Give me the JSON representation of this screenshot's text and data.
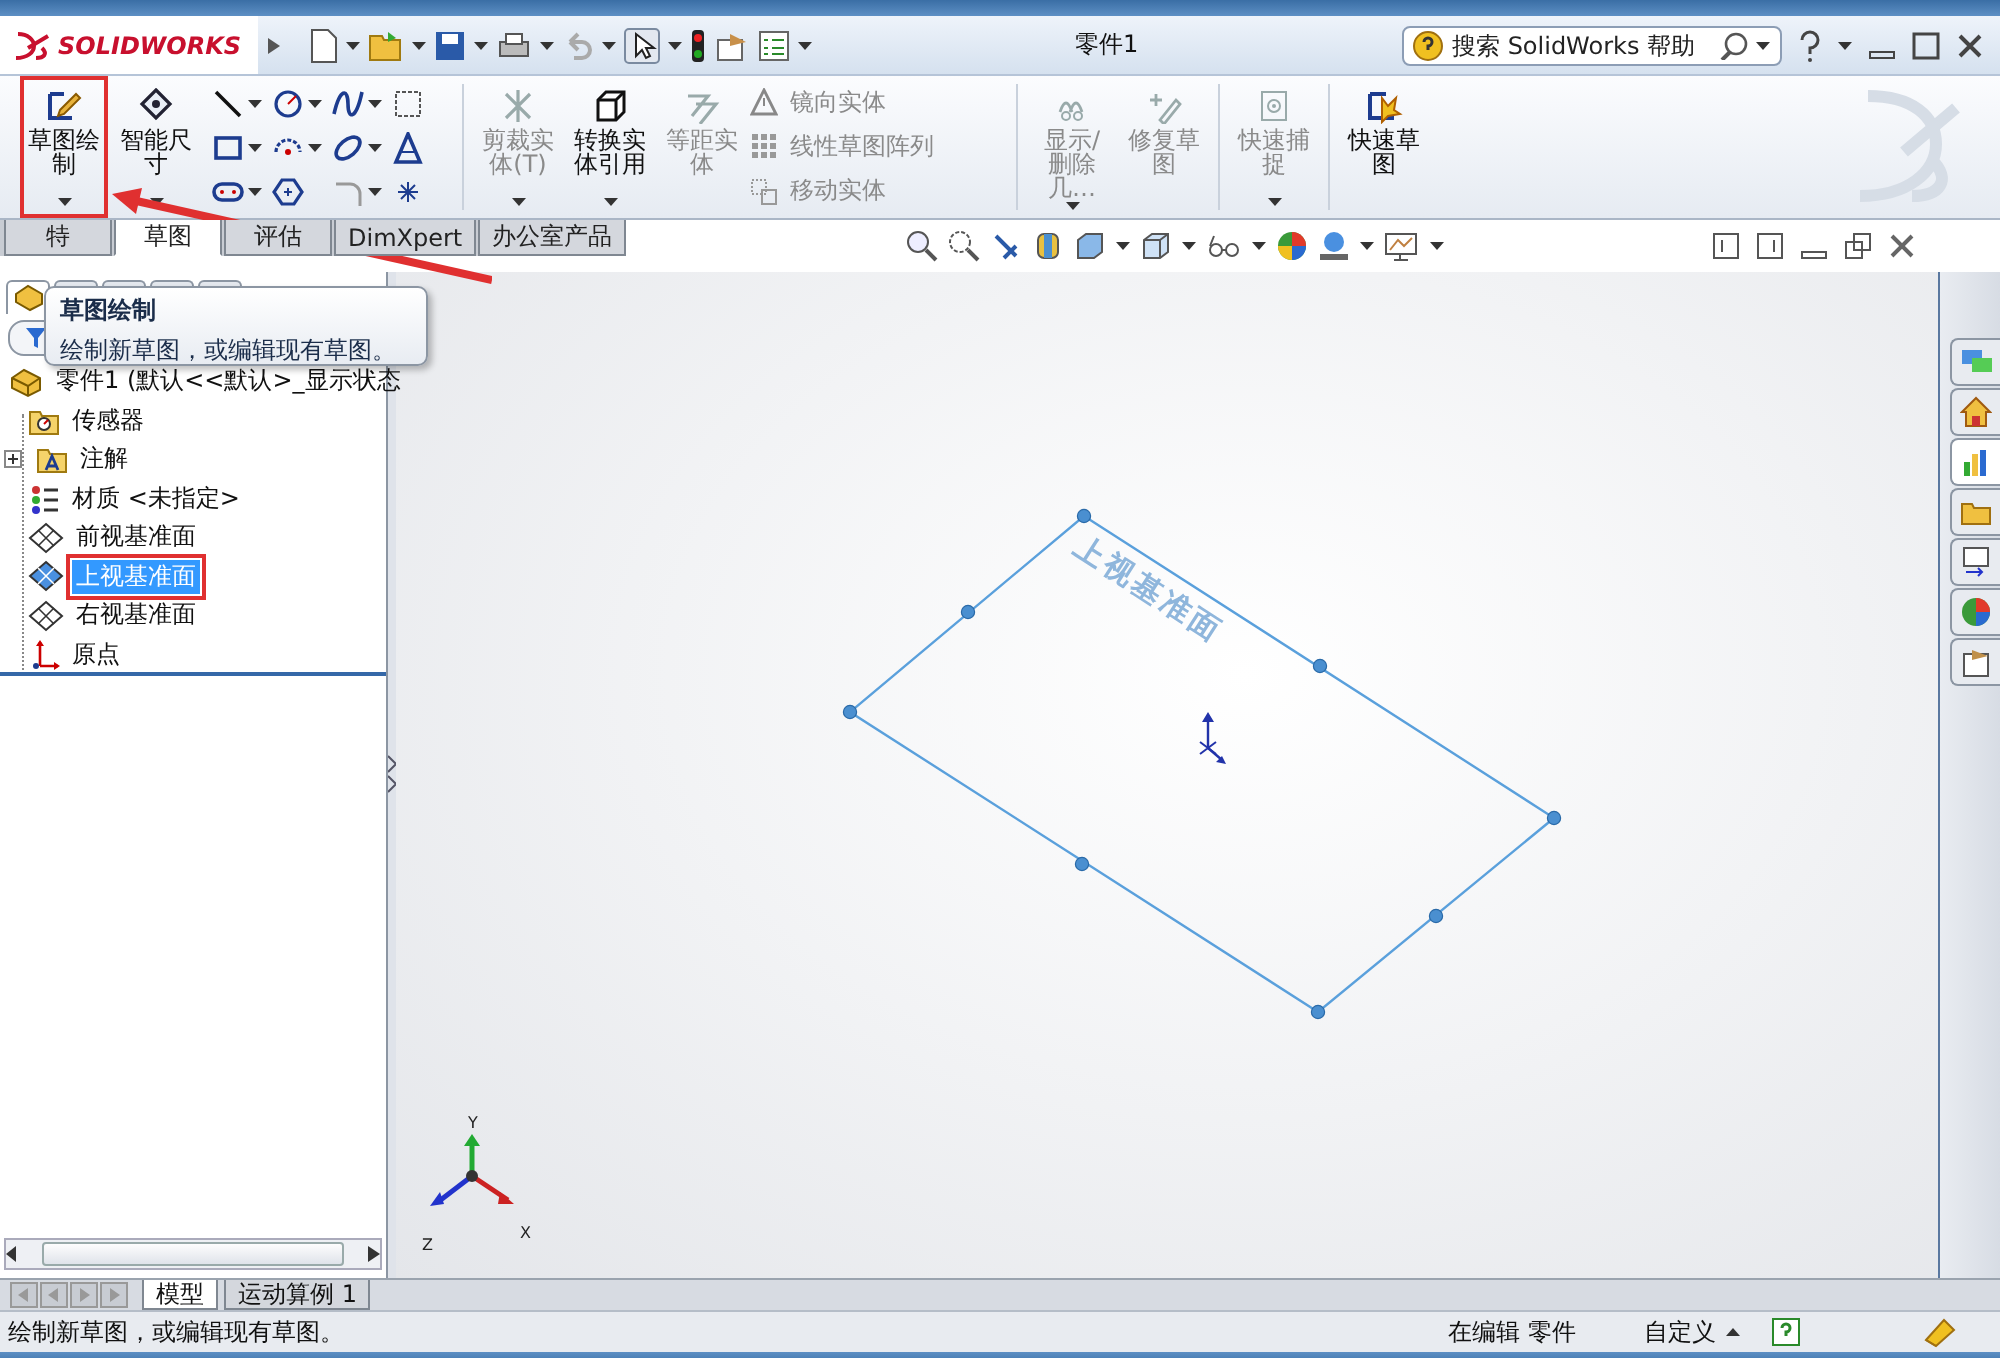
{
  "window": {
    "title": "零件1"
  },
  "logo": {
    "text": "SOLIDWORKS"
  },
  "search": {
    "placeholder": "搜索 SolidWorks 帮助"
  },
  "ribbon": {
    "items": [
      {
        "kind": "large",
        "label": "草图绘制",
        "disabled": false,
        "highlighted": true,
        "dropdown": true
      },
      {
        "kind": "large",
        "label": "智能尺寸",
        "disabled": false,
        "highlighted": false,
        "dropdown": true
      },
      {
        "kind": "tools"
      },
      {
        "kind": "large",
        "label": "剪裁实体(T)",
        "disabled": true,
        "highlighted": false,
        "dropdown": true
      },
      {
        "kind": "large",
        "label": "转换实体引用",
        "disabled": false,
        "highlighted": false,
        "dropdown": true
      },
      {
        "kind": "large",
        "label": "等距实体",
        "disabled": true,
        "highlighted": false,
        "dropdown": false
      },
      {
        "kind": "list",
        "entries": [
          {
            "label": "镜向实体",
            "disabled": true
          },
          {
            "label": "线性草图阵列",
            "disabled": true
          },
          {
            "label": "移动实体",
            "disabled": true
          }
        ]
      },
      {
        "kind": "large",
        "label": "显示/删除几…",
        "disabled": true,
        "highlighted": false,
        "dropdown": true
      },
      {
        "kind": "large",
        "label": "修复草图",
        "disabled": true,
        "highlighted": false,
        "dropdown": false
      },
      {
        "kind": "large",
        "label": "快速捕捉",
        "disabled": true,
        "highlighted": false,
        "dropdown": true
      },
      {
        "kind": "large",
        "label": "快速草图",
        "disabled": false,
        "highlighted": false,
        "dropdown": false
      }
    ]
  },
  "tabs": [
    {
      "label": "特",
      "selected": false
    },
    {
      "label": "草图",
      "selected": true
    },
    {
      "label": "评估",
      "selected": false
    },
    {
      "label": "DimXpert",
      "selected": false
    },
    {
      "label": "办公室产品",
      "selected": false
    }
  ],
  "tooltip": {
    "title": "草图绘制",
    "text": "绘制新草图，或编辑现有草图。"
  },
  "tree": {
    "items": [
      {
        "label": "零件1 (默认<<默认>_显示状态",
        "kind": "part",
        "selected": false,
        "highlighted": false,
        "children": [
          {
            "label": "传感器",
            "kind": "sensor",
            "selected": false,
            "highlighted": false
          },
          {
            "label": "注解",
            "kind": "annotation",
            "selected": false,
            "highlighted": false,
            "expanded": false
          },
          {
            "label": "材质 <未指定>",
            "kind": "material",
            "selected": false,
            "highlighted": false
          },
          {
            "label": "前视基准面",
            "kind": "plane",
            "selected": false,
            "highlighted": false
          },
          {
            "label": "上视基准面",
            "kind": "plane",
            "selected": true,
            "highlighted": true
          },
          {
            "label": "右视基准面",
            "kind": "plane",
            "selected": false,
            "highlighted": false
          },
          {
            "label": "原点",
            "kind": "origin",
            "selected": false,
            "highlighted": false
          }
        ]
      }
    ]
  },
  "viewport": {
    "plane_label": "上视基准面",
    "axes": [
      "X",
      "Y",
      "Z"
    ]
  },
  "bottom_tabs": [
    {
      "label": "模型",
      "selected": true
    },
    {
      "label": "运动算例 1",
      "selected": false
    }
  ],
  "status_bar": {
    "message": "绘制新草图，或编辑现有草图。",
    "mode": "在编辑 零件",
    "units": "自定义"
  }
}
